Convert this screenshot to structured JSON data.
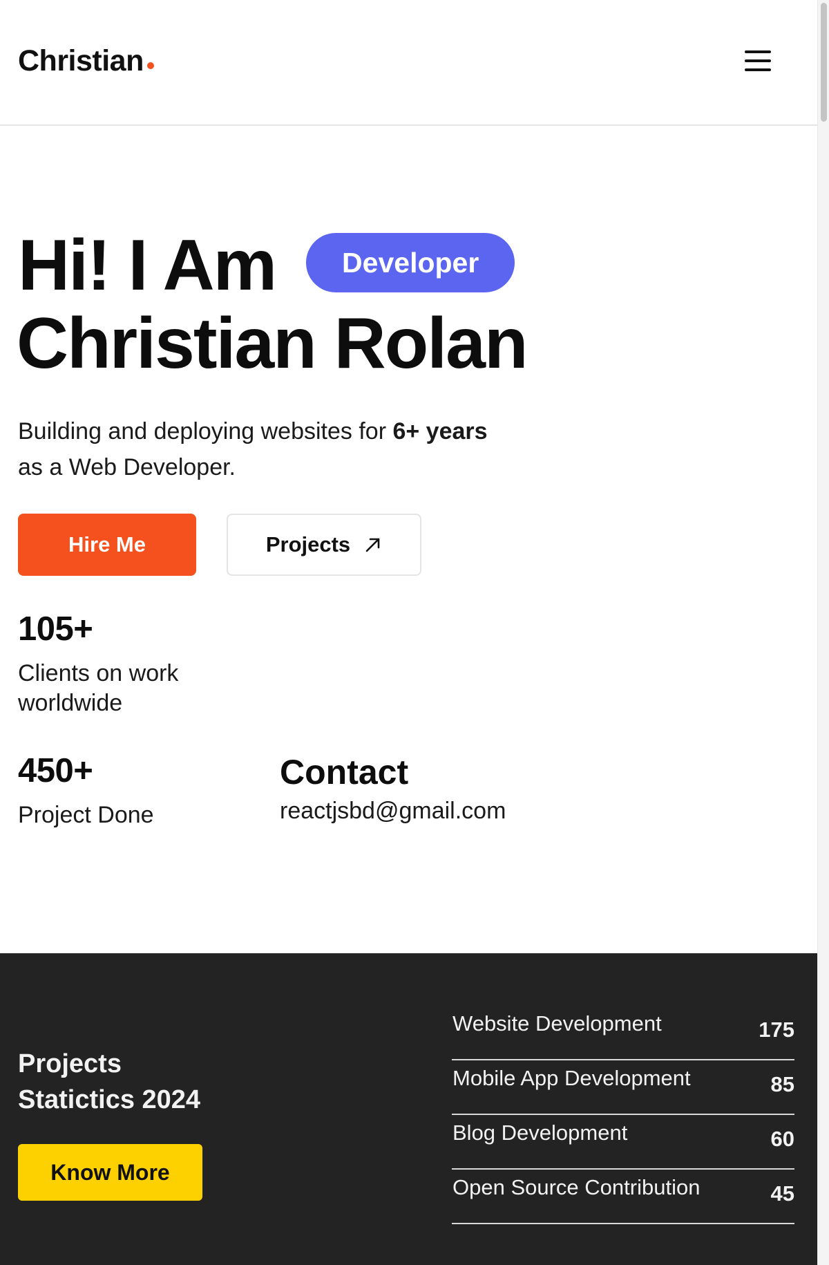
{
  "header": {
    "logo_text": "Christian",
    "logo_dot_color": "#f4511e",
    "menu_icon": "hamburger-menu-icon"
  },
  "hero": {
    "greeting": "Hi! I Am",
    "role_badge": "Developer",
    "name": "Christian Rolan",
    "intro_prefix": "Building and deploying websites for",
    "intro_highlight": "6+ years",
    "intro_suffix": "as a Web Developer.",
    "hire_button": "Hire Me",
    "projects_button": "Projects",
    "projects_button_icon": "arrow-up-right-icon",
    "accent_color": "#f4511e",
    "badge_color": "#5b65f0"
  },
  "stats": {
    "clients_number": "105+",
    "clients_label_line1": "Clients on work",
    "clients_label_line2": "worldwide",
    "projects_number": "450+",
    "projects_label": "Project Done"
  },
  "contact": {
    "title": "Contact",
    "email": "reactjsbd@gmail.com"
  },
  "statistics": {
    "heading_line1": "Projects",
    "heading_line2": "Statictics 2024",
    "know_more_button": "Know More",
    "button_color": "#fdd000",
    "background_color": "#232323",
    "items": [
      {
        "name": "Website Development",
        "value": "175"
      },
      {
        "name": "Mobile App Development",
        "value": "85"
      },
      {
        "name": "Blog Development",
        "value": "60"
      },
      {
        "name": "Open Source Contribution",
        "value": "45"
      }
    ]
  }
}
